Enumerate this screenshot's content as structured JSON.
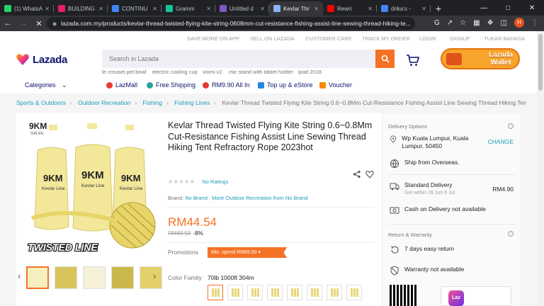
{
  "browser": {
    "tabs": [
      {
        "title": "(1) WhatsA",
        "color": "#25d366"
      },
      {
        "title": "BUILDING",
        "color": "#e91e63"
      },
      {
        "title": "CONTINU",
        "color": "#4285f4"
      },
      {
        "title": "Gramm",
        "color": "#15c39a"
      },
      {
        "title": "Untitled d",
        "color": "#7e57c2"
      },
      {
        "title": "Kevlar Thr",
        "color": "#8ab4f8",
        "active": true
      },
      {
        "title": "Rewri",
        "color": "#ff0000"
      },
      {
        "title": "drika's -",
        "color": "#4285f4"
      }
    ],
    "url": "lazada.com.my/products/kevlar-thread-twisted-flying-kite-string-0608mm-cut-resistance-fishing-assist-line-sewing-thread-hiking-te...",
    "profile_initial": "H"
  },
  "topbar": {
    "items": [
      "SAVE MORE ON APP",
      "SELL ON LAZADA",
      "CUSTOMER CARE",
      "TRACK MY ORDER",
      "LOGIN",
      "SIGNUP",
      "TUKAR BAHASA"
    ]
  },
  "header": {
    "logo": "Lazada",
    "search_placeholder": "Search in Lazada",
    "keywords": [
      "le creuset pet bowl",
      "electric cooling cup",
      "viomi v2",
      "mic stand with tablet holder",
      "ipad 2018"
    ],
    "wallet_label_1": "Lazada",
    "wallet_label_2": "Wallet"
  },
  "nav": {
    "categories": "Categories",
    "items": [
      {
        "label": "LazMall",
        "color": "#e53935"
      },
      {
        "label": "Free Shipping",
        "color": "#26a69a"
      },
      {
        "label": "RM9.90 All In",
        "color": "#e53935"
      },
      {
        "label": "Top up & eStore",
        "color": "#1e88e5"
      },
      {
        "label": "Voucher",
        "color": "#fb8c00"
      }
    ]
  },
  "breadcrumb": {
    "links": [
      "Sports & Outdoors",
      "Outdoor Recreation",
      "Fishing",
      "Fishing Lines"
    ],
    "current": "Kevlar Thread Twisted Flying Kite String 0.6~0.8Mm Cut-Resistance Fishing Assist Line Sewing Thread Hiking Tent"
  },
  "product": {
    "image_brand": "9KM",
    "image_brand_sub": "SWLIFE",
    "image_spool_label": "Kevlar Line",
    "image_caption": "TWISTED LINE",
    "title": "Kevlar Thread Twisted Flying Kite String 0.6~0.8Mm Cut-Resistance Fishing Assist Line Sewing Thread Hiking Tent Refractory Rope 2023hot",
    "ratings": "No Ratings",
    "brand_label": "Brand:",
    "brand_value": "No Brand",
    "more_from": "More Outdoor Recreation from No Brand",
    "price": "RM44.54",
    "old_price": "RM48.58",
    "discount": "-8%",
    "promotions_label": "Promotions",
    "promotion_tag": "Min. spend RM65.00",
    "color_family_label": "Color Family",
    "color_family_value": "70lb 1000ft 304m"
  },
  "delivery": {
    "options_header": "Delivery Options",
    "location": "Wp Kuala Lumpur, Kuala Lumpur, 50450",
    "change": "CHANGE",
    "ship_from": "Ship from Overseas.",
    "standard_title": "Standard Delivery",
    "standard_sub": "Get within 26 Jun-5 Jul",
    "standard_price": "RM4.90",
    "cod": "Cash on Delivery not available",
    "return_header": "Return & Warranty",
    "returns": "7 days easy return",
    "warranty": "Warranty not available",
    "app_logo": "Laz"
  }
}
